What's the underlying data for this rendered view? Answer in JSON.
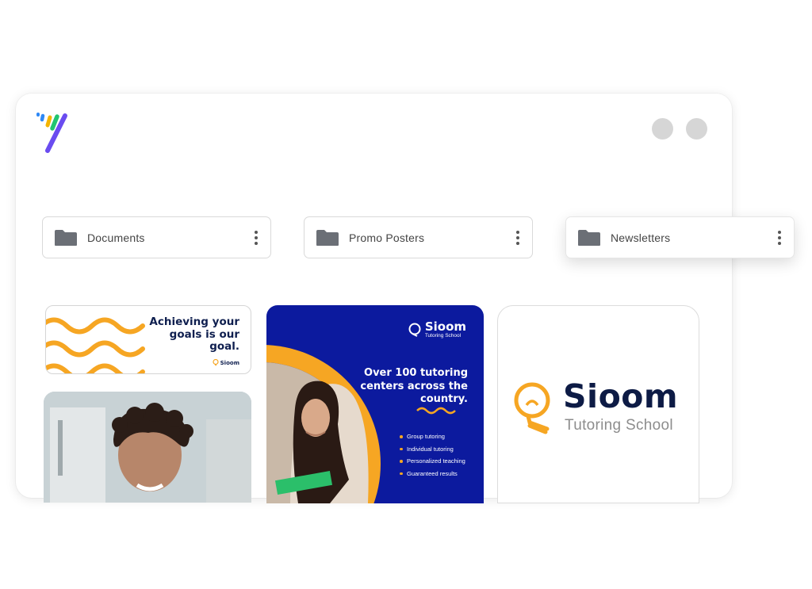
{
  "app": {
    "logo_icon": "brand-logo",
    "window_controls": [
      "window-control-1",
      "window-control-2"
    ]
  },
  "folders": [
    {
      "label": "Documents",
      "icon": "folder-icon",
      "menu_icon": "more-vertical-icon"
    },
    {
      "label": "Promo Posters",
      "icon": "folder-icon",
      "menu_icon": "more-vertical-icon"
    },
    {
      "label": "Newsletters",
      "icon": "folder-icon",
      "menu_icon": "more-vertical-icon"
    }
  ],
  "cards": {
    "banner": {
      "title": "Achieving your goals is our goal.",
      "logo_text": "Sioom"
    },
    "poster": {
      "brand_name": "Sioom",
      "brand_sub": "Tutoring School",
      "headline": "Over 100 tutoring centers across the country.",
      "bullets": [
        "Group tutoring",
        "Individual tutoring",
        "Personalized teaching",
        "Guaranteed results"
      ]
    },
    "brand": {
      "name": "Sioom",
      "subtitle": "Tutoring School"
    }
  },
  "colors": {
    "accent_orange": "#f6a623",
    "navy": "#0d1b45",
    "poster_blue": "#0c1a9e",
    "folder_gray": "#6b6f76"
  }
}
